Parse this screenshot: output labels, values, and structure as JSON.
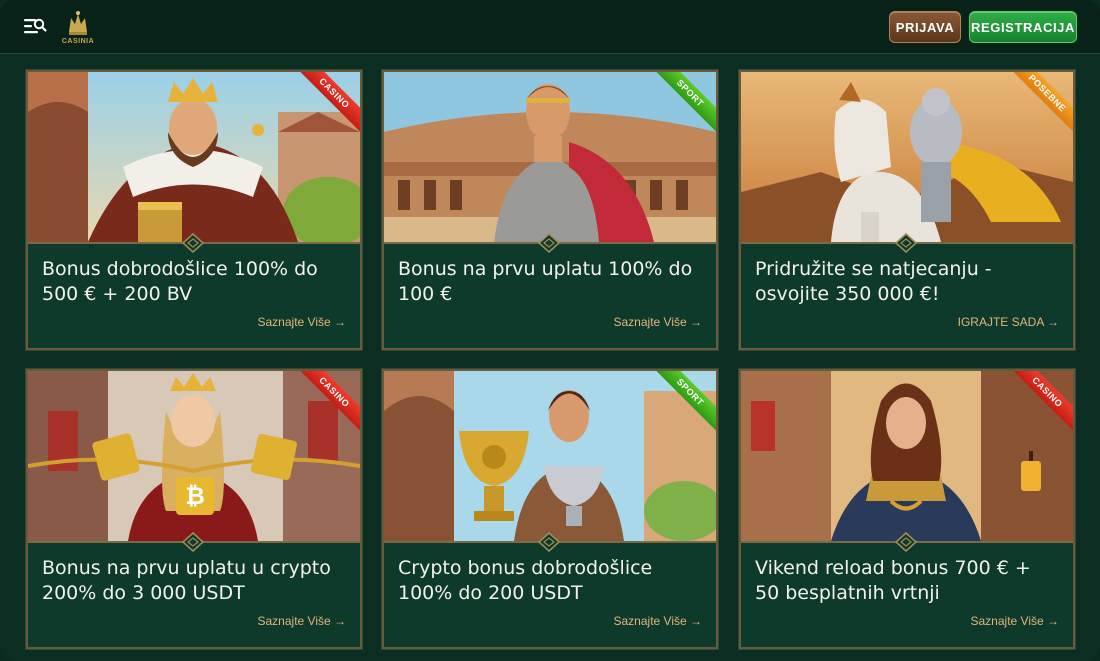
{
  "header": {
    "logo_text": "CASINIA",
    "login_label": "PRIJAVA",
    "register_label": "REGISTRACIJA"
  },
  "cards": [
    {
      "tag": "CASINO",
      "title": "Bonus dobrodošlice 100% do 500 € + 200 BV",
      "link": "Saznajte Više →",
      "image": "king-with-treasure"
    },
    {
      "tag": "SPORT",
      "title": "Bonus na prvu uplatu 100% do 100 €",
      "link": "Saznajte Više →",
      "image": "gladiator-in-arena"
    },
    {
      "tag": "POSEBNE",
      "title": "Pridružite se natjecanju - osvojite 350 000 €!",
      "link": "IGRAJTE SADA →",
      "image": "knight-on-horse"
    },
    {
      "tag": "CASINO",
      "title": "Bonus na prvu uplatu u crypto 200% do 3 000 USDT",
      "link": "Saznajte Više →",
      "image": "queen-with-crypto-coins"
    },
    {
      "tag": "SPORT",
      "title": "Crypto bonus dobrodošlice 100% do 200 USDT",
      "link": "Saznajte Više →",
      "image": "man-with-trophies"
    },
    {
      "tag": "CASINO",
      "title": "Vikend reload bonus 700 € + 50 besplatnih vrtnji",
      "link": "Saznajte Više →",
      "image": "warrior-woman-in-street"
    }
  ],
  "colors": {
    "background": "#0b2d22",
    "card": "#0d3a2b",
    "link": "#e5b47a",
    "casino_tag": "#e2281e",
    "sport_tag": "#45b51e",
    "posebne_tag": "#f0901b"
  }
}
